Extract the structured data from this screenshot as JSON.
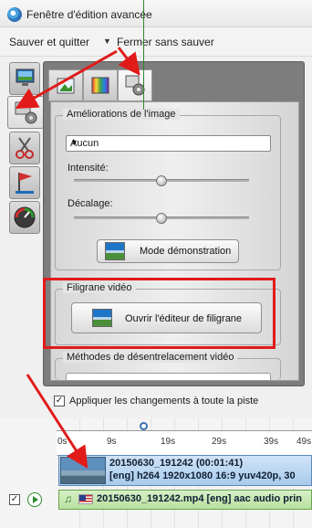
{
  "window": {
    "title": "Fenêtre d'édition avancée"
  },
  "menu": {
    "save_quit": "Sauver et quitter",
    "close_without_save": "Fermer sans sauver"
  },
  "image_enhancements": {
    "legend": "Améliorations de l'image",
    "preset_selected": "Aucun",
    "intensity_label": "Intensité:",
    "intensity_level": 0.5,
    "offset_label": "Décalage:",
    "offset_level": 0.5,
    "demo_button": "Mode démonstration"
  },
  "watermark": {
    "legend": "Filigrane vidéo",
    "editor_button": "Ouvrir l'éditeur de filigrane"
  },
  "deinterlace": {
    "legend": "Méthodes de désentrelacement vidéo"
  },
  "apply_all": {
    "label": "Appliquer les changements à toute la piste",
    "checked": true
  },
  "timeline": {
    "ticks": [
      "0s",
      "9s",
      "19s",
      "29s",
      "39s",
      "49s"
    ],
    "video_clip": {
      "line1": "20150630_191242 (00:01:41)",
      "line2": "[eng] h264 1920x1080 16:9 yuv420p, 30"
    },
    "audio_clip": {
      "text": "20150630_191242.mp4 [eng] aac audio prin"
    },
    "track_checked": true
  },
  "colors": {
    "highlight": "#e11a1a",
    "panel": "#7d7d7d",
    "playhead": "#2a8a2a"
  }
}
